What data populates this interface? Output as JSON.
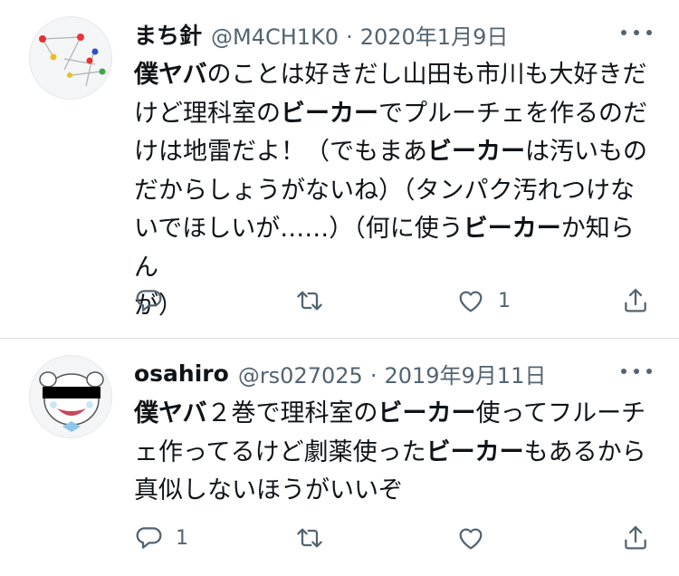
{
  "tweets": [
    {
      "name": "まち針",
      "handle": "@M4CH1K0",
      "date": "2020年1月9日",
      "segments": [
        {
          "t": "僕ヤバ",
          "b": true
        },
        {
          "t": "のことは好きだし山田も市川も大好きだ",
          "b": false
        },
        {
          "t": "\n",
          "b": false
        },
        {
          "t": "けど理科室の",
          "b": false
        },
        {
          "t": "ビーカー",
          "b": true
        },
        {
          "t": "でプルーチェを作るのだ",
          "b": false
        },
        {
          "t": "\n",
          "b": false
        },
        {
          "t": "けは地雷だよ！（でもまあ",
          "b": false
        },
        {
          "t": "ビーカー",
          "b": true
        },
        {
          "t": "は汚いもの",
          "b": false
        },
        {
          "t": "\n",
          "b": false
        },
        {
          "t": "だからしょうがないね）（タンパク汚れつけな",
          "b": false
        },
        {
          "t": "\n",
          "b": false
        },
        {
          "t": "いでほしいが……）（何に使う",
          "b": false
        },
        {
          "t": "ビーカー",
          "b": true
        },
        {
          "t": "か知らん",
          "b": false
        },
        {
          "t": "\n",
          "b": false
        },
        {
          "t": "が）",
          "b": false
        }
      ],
      "reply_count": "",
      "retweet_count": "",
      "like_count": "1",
      "icons": {
        "reply": "reply-icon",
        "retweet": "retweet-icon",
        "like": "like-icon",
        "share": "share-icon"
      }
    },
    {
      "name": "osahiro",
      "handle": "@rs027025",
      "date": "2019年9月11日",
      "segments": [
        {
          "t": "僕ヤバ",
          "b": true
        },
        {
          "t": "２巻で理科室の",
          "b": false
        },
        {
          "t": "ビーカー",
          "b": true
        },
        {
          "t": "使ってフルーチ",
          "b": false
        },
        {
          "t": "\n",
          "b": false
        },
        {
          "t": "ェ作ってるけど劇薬使った",
          "b": false
        },
        {
          "t": "ビーカー",
          "b": true
        },
        {
          "t": "もあるから",
          "b": false
        },
        {
          "t": "\n",
          "b": false
        },
        {
          "t": "真似しないほうがいいぞ",
          "b": false
        }
      ],
      "reply_count": "1",
      "retweet_count": "",
      "like_count": "",
      "icons": {
        "reply": "reply-icon",
        "retweet": "retweet-icon",
        "like": "like-icon",
        "share": "share-icon"
      }
    }
  ],
  "colors": {
    "text": "#0f1419",
    "secondary": "#536471",
    "divider": "#d9dde1"
  }
}
